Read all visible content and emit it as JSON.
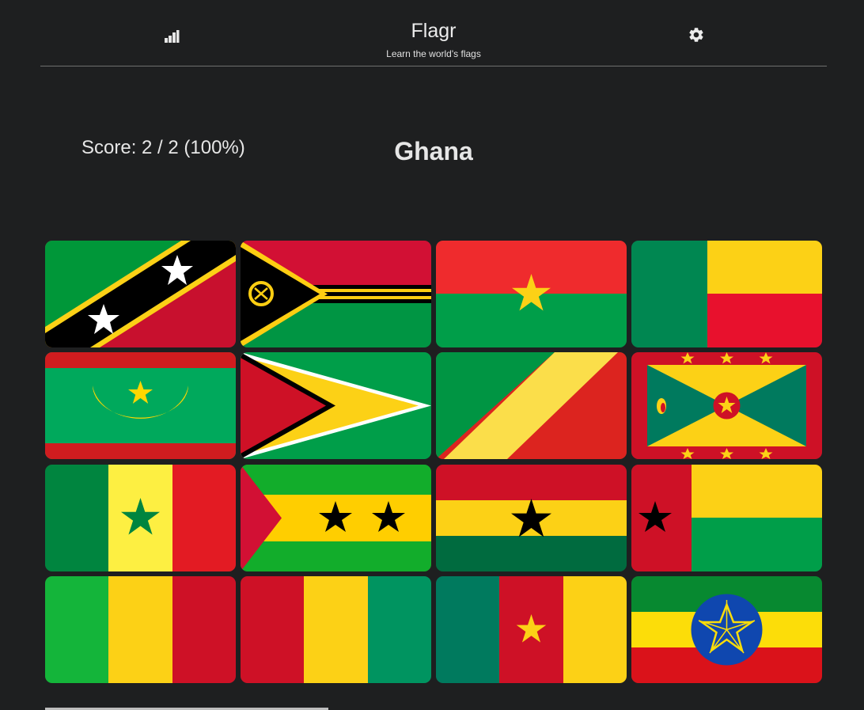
{
  "header": {
    "title": "Flagr",
    "subtitle": "Learn the world's flags",
    "stats_icon": "bar-chart-icon",
    "settings_icon": "gear-icon"
  },
  "quiz": {
    "score": "Score: 2 / 2 (100%)",
    "country": "Ghana"
  },
  "flags": [
    "saint-kitts-and-nevis",
    "vanuatu",
    "burkina-faso",
    "benin",
    "mauritania",
    "guyana",
    "republic-of-the-congo",
    "grenada",
    "senegal",
    "sao-tome-and-principe",
    "ghana",
    "guinea-bissau",
    "mali",
    "guinea",
    "cameroon",
    "ethiopia"
  ]
}
